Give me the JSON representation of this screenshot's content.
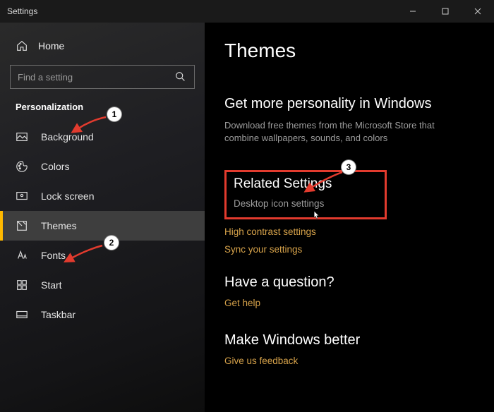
{
  "window": {
    "title": "Settings"
  },
  "home": {
    "label": "Home"
  },
  "search": {
    "placeholder": "Find a setting"
  },
  "category": {
    "label": "Personalization"
  },
  "nav": {
    "items": [
      {
        "label": "Background"
      },
      {
        "label": "Colors"
      },
      {
        "label": "Lock screen"
      },
      {
        "label": "Themes"
      },
      {
        "label": "Fonts"
      },
      {
        "label": "Start"
      },
      {
        "label": "Taskbar"
      }
    ]
  },
  "page": {
    "title": "Themes"
  },
  "more": {
    "heading": "Get more personality in Windows",
    "desc": "Download free themes from the Microsoft Store that combine wallpapers, sounds, and colors"
  },
  "related": {
    "heading": "Related Settings",
    "desktop_icon": "Desktop icon settings",
    "high_contrast": "High contrast settings",
    "sync": "Sync your settings"
  },
  "question": {
    "heading": "Have a question?",
    "link": "Get help"
  },
  "better": {
    "heading": "Make Windows better",
    "link": "Give us feedback"
  },
  "annotations": {
    "n1": "1",
    "n2": "2",
    "n3": "3"
  }
}
